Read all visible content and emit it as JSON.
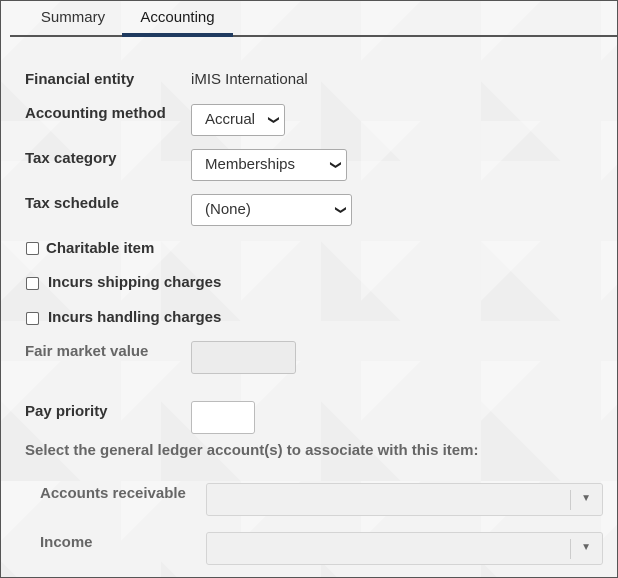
{
  "tabs": {
    "summary": "Summary",
    "accounting": "Accounting"
  },
  "form": {
    "financial_entity": {
      "label": "Financial entity",
      "value": "iMIS International"
    },
    "accounting_method": {
      "label": "Accounting method",
      "value": "Accrual"
    },
    "tax_category": {
      "label": "Tax category",
      "value": "Memberships"
    },
    "tax_schedule": {
      "label": "Tax schedule",
      "value": "(None)"
    },
    "charitable_item": {
      "label": "Charitable item",
      "checked": false
    },
    "incurs_shipping": {
      "label": "Incurs shipping charges",
      "checked": false
    },
    "incurs_handling": {
      "label": "Incurs handling charges",
      "checked": false
    },
    "fair_market_value": {
      "label": "Fair market value",
      "value": ""
    },
    "pay_priority": {
      "label": "Pay priority",
      "value": ""
    },
    "gl_instruction": "Select the general ledger account(s) to associate with this item:",
    "accounts_receivable": {
      "label": "Accounts receivable",
      "value": ""
    },
    "income": {
      "label": "Income",
      "value": ""
    }
  },
  "icons": {
    "dropdown": "chevron-down-icon",
    "combo_arrow": "triangle-down-icon"
  },
  "colors": {
    "active_tab_underline": "#1f3a5f",
    "background": "#f3f3f3"
  }
}
